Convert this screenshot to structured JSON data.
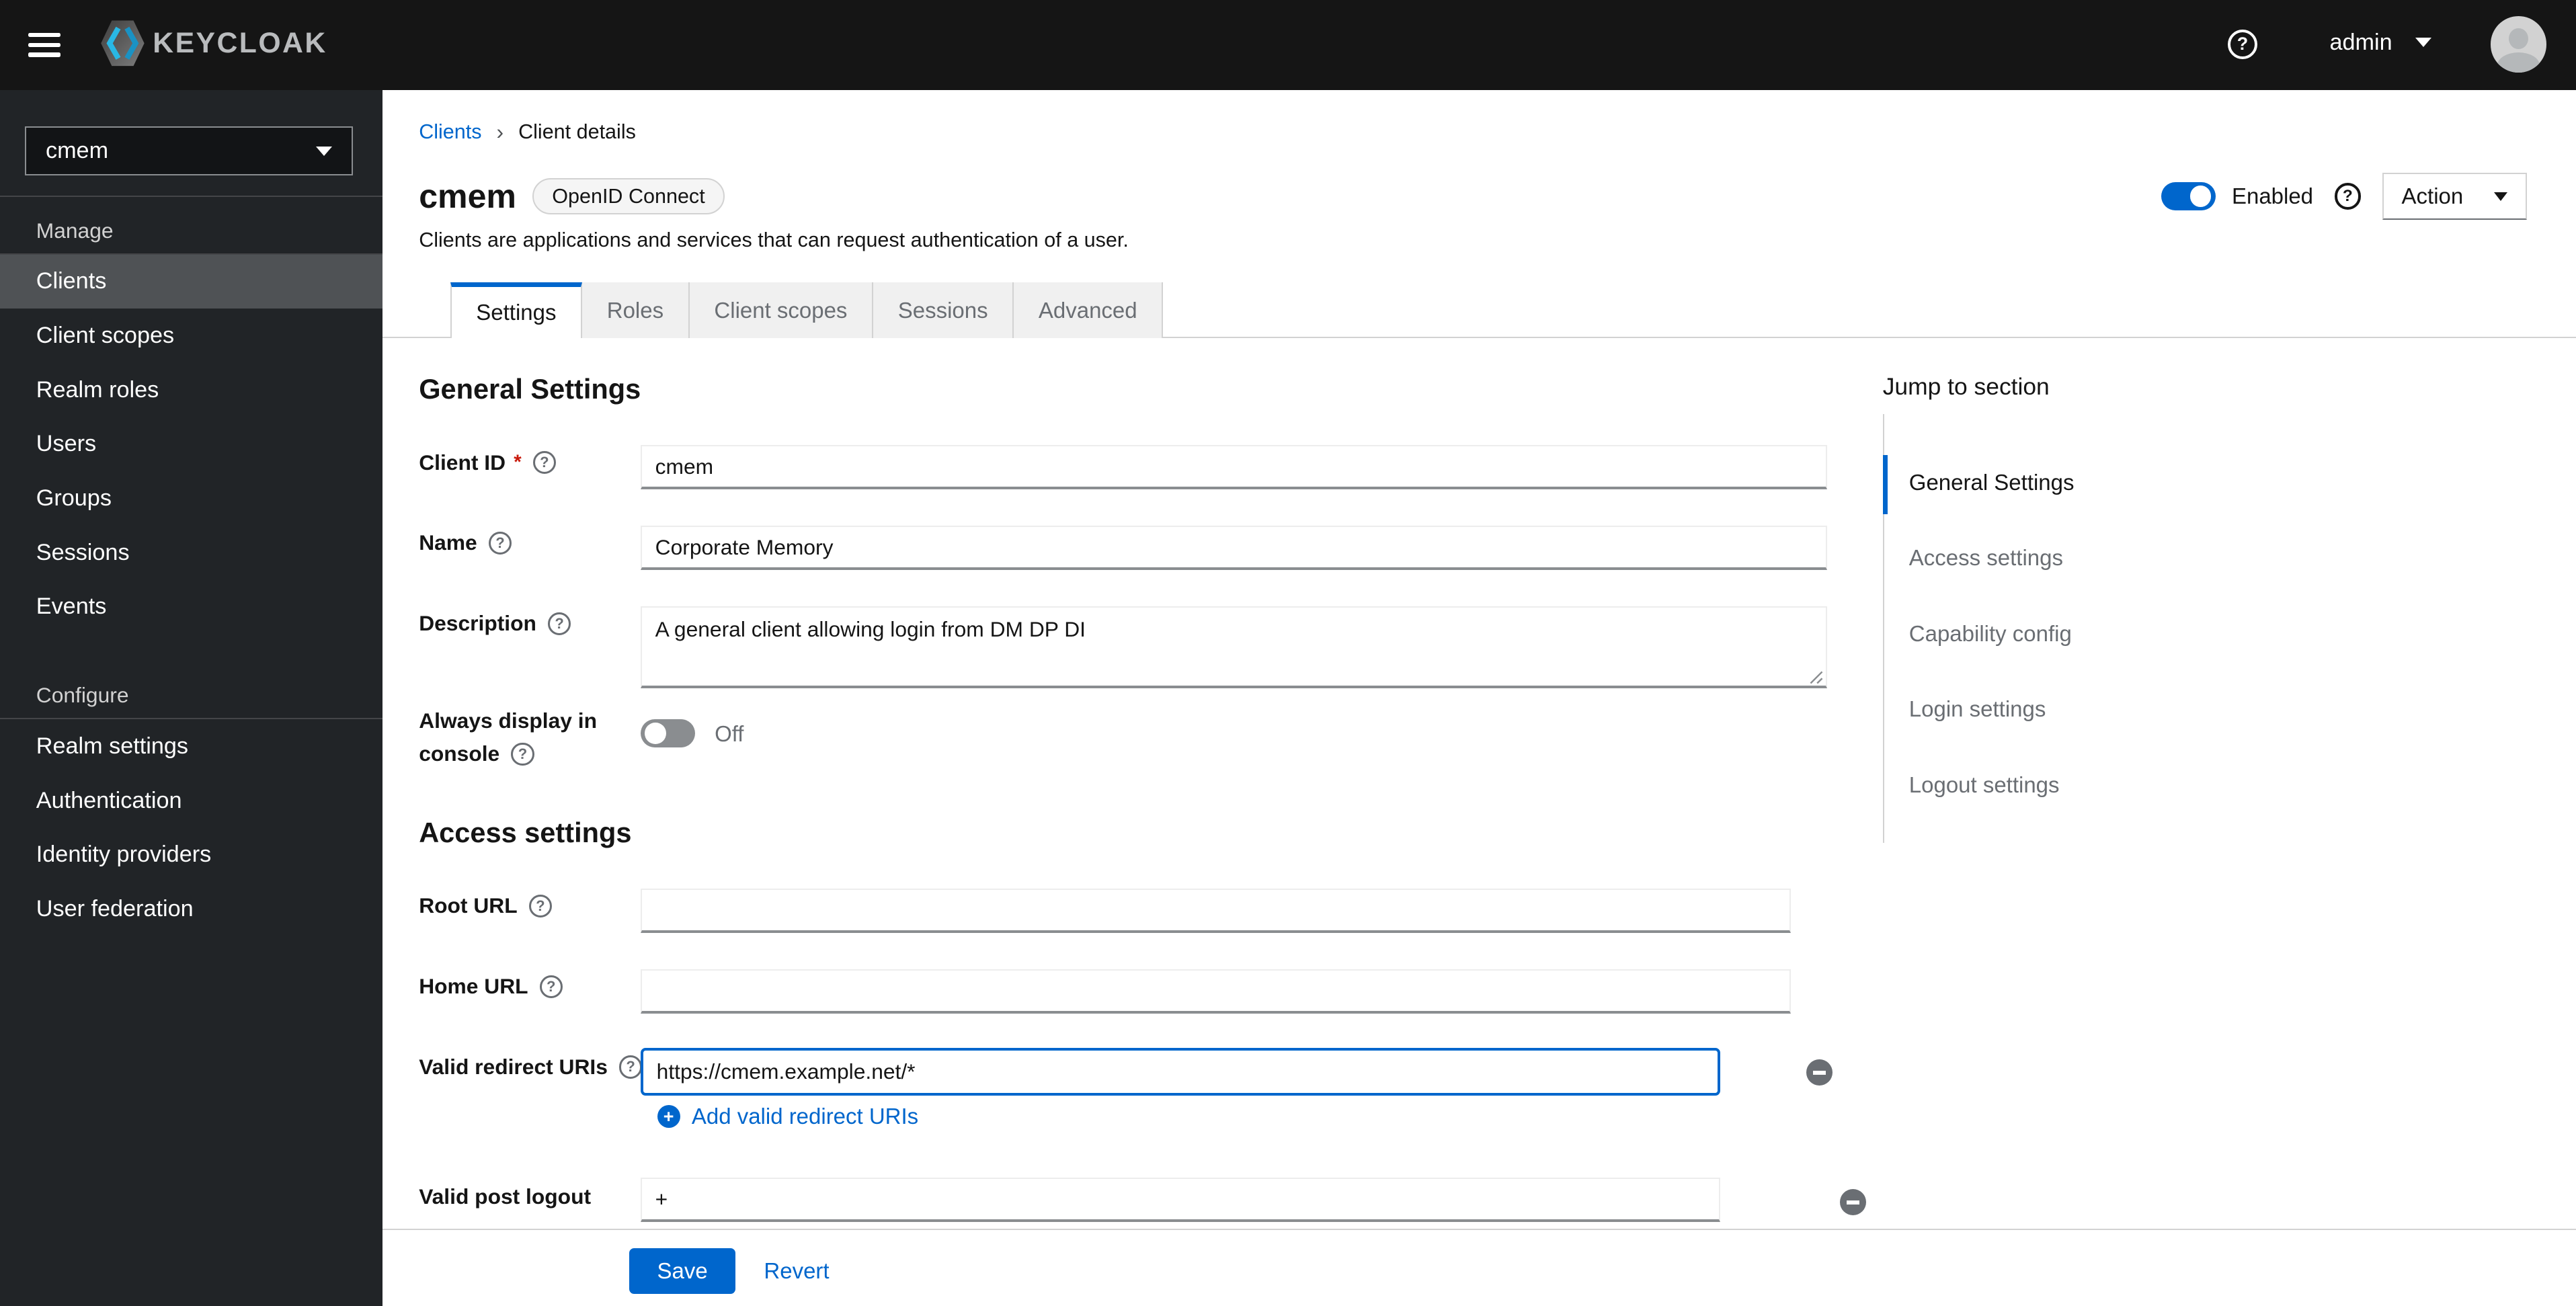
{
  "header": {
    "brand": "KEYCLOAK",
    "user": "admin"
  },
  "icons": {
    "help": "?",
    "breadcrumb_sep": "›",
    "plus": "+",
    "asterisk": "*"
  },
  "sidebar": {
    "realm": "cmem",
    "groups": [
      {
        "label": "Manage",
        "items": [
          {
            "label": "Clients",
            "active": true
          },
          {
            "label": "Client scopes"
          },
          {
            "label": "Realm roles"
          },
          {
            "label": "Users"
          },
          {
            "label": "Groups"
          },
          {
            "label": "Sessions"
          },
          {
            "label": "Events"
          }
        ]
      },
      {
        "label": "Configure",
        "items": [
          {
            "label": "Realm settings"
          },
          {
            "label": "Authentication"
          },
          {
            "label": "Identity providers"
          },
          {
            "label": "User federation"
          }
        ]
      }
    ]
  },
  "breadcrumb": {
    "parent": "Clients",
    "current": "Client details"
  },
  "page": {
    "title": "cmem",
    "badge": "OpenID Connect",
    "subtitle": "Clients are applications and services that can request authentication of a user.",
    "enabled_label": "Enabled",
    "action_label": "Action"
  },
  "tabs": [
    {
      "label": "Settings",
      "active": true
    },
    {
      "label": "Roles"
    },
    {
      "label": "Client scopes"
    },
    {
      "label": "Sessions"
    },
    {
      "label": "Advanced"
    }
  ],
  "form": {
    "general_heading": "General Settings",
    "client_id": {
      "label": "Client ID",
      "value": "cmem"
    },
    "name": {
      "label": "Name",
      "value": "Corporate Memory"
    },
    "description": {
      "label": "Description",
      "value": "A general client allowing login from DM DP DI"
    },
    "always_display": {
      "label_line1": "Always display in",
      "label_line2": "console",
      "state": "Off"
    },
    "access_heading": "Access settings",
    "root_url": {
      "label": "Root URL",
      "value": ""
    },
    "home_url": {
      "label": "Home URL",
      "value": ""
    },
    "valid_redirect": {
      "label": "Valid redirect URIs",
      "value": "https://cmem.example.net/*",
      "add_label": "Add valid redirect URIs"
    },
    "post_logout": {
      "label": "Valid post logout",
      "value": "+"
    }
  },
  "jump_nav": {
    "heading": "Jump to section",
    "items": [
      {
        "label": "General Settings",
        "active": true
      },
      {
        "label": "Access settings"
      },
      {
        "label": "Capability config"
      },
      {
        "label": "Login settings"
      },
      {
        "label": "Logout settings"
      }
    ]
  },
  "footer": {
    "save": "Save",
    "revert": "Revert"
  },
  "colors": {
    "accent": "#0066cc",
    "header_bg": "#151515",
    "sidebar_bg": "#212427",
    "sidebar_active": "#4f5255",
    "danger": "#c9190b",
    "muted": "#6a6e73",
    "border": "#d2d2d2",
    "input_bottom_border": "#8a8d90",
    "tab_bg": "#f0f0f0"
  }
}
